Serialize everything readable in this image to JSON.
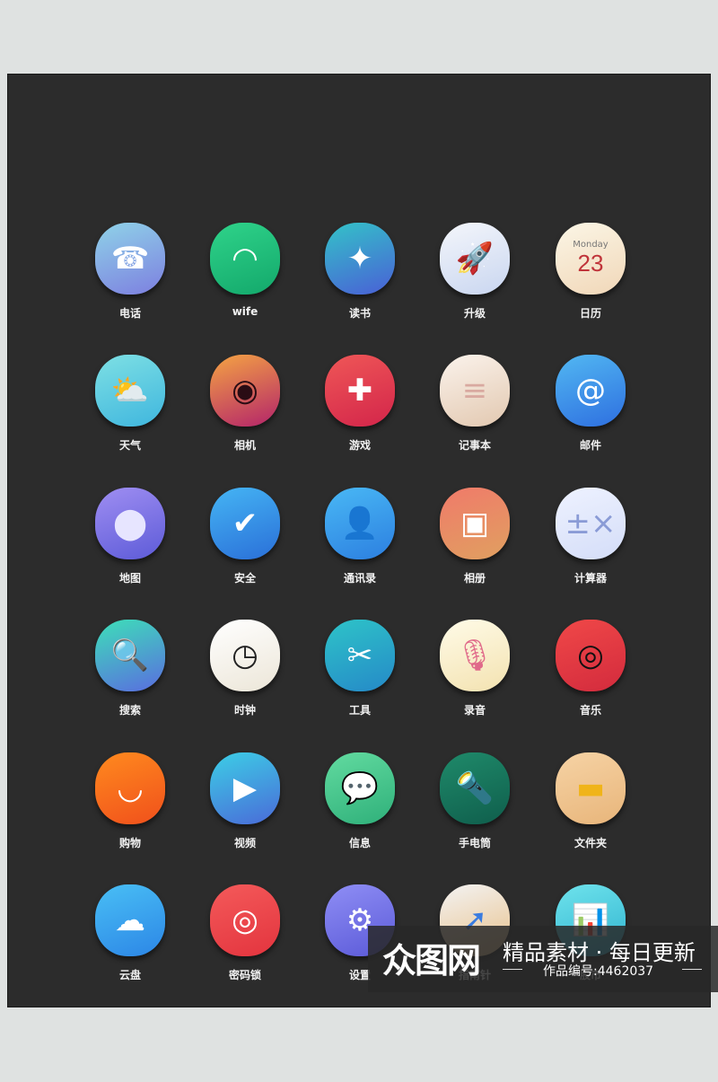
{
  "apps": [
    {
      "label": "电话",
      "icon": "telephone-icon",
      "glyph": "☎",
      "c1": "#8fd3e8",
      "c2": "#7d7fe0"
    },
    {
      "label": "wife",
      "icon": "wifi-icon",
      "glyph": "◠",
      "c1": "#2fd38a",
      "c2": "#13a86b"
    },
    {
      "label": "读书",
      "icon": "book-icon",
      "glyph": "✦",
      "c1": "#33c3c8",
      "c2": "#4a5fd6"
    },
    {
      "label": "升级",
      "icon": "rocket-icon",
      "glyph": "🚀",
      "c1": "#f4f6fb",
      "c2": "#c9d6f0",
      "fg": "#f08a1a"
    },
    {
      "label": "日历",
      "icon": "calendar-icon",
      "calendar": {
        "day": "Monday",
        "date": "23"
      },
      "c1": "#fbf6e6",
      "c2": "#f1d7b8"
    },
    {
      "label": "天气",
      "icon": "weather-icon",
      "glyph": "⛅",
      "c1": "#7ee0e4",
      "c2": "#3fb6de"
    },
    {
      "label": "相机",
      "icon": "camera-icon",
      "glyph": "◉",
      "c1": "#f5a443",
      "c2": "#b3236a",
      "fg": "#2a0c14"
    },
    {
      "label": "游戏",
      "icon": "gamepad-icon",
      "glyph": "✚",
      "c1": "#ef5757",
      "c2": "#d3254a"
    },
    {
      "label": "记事本",
      "icon": "notebook-icon",
      "glyph": "≡",
      "c1": "#fbf3ec",
      "c2": "#e2c8b0",
      "fg": "#d9a9a0"
    },
    {
      "label": "邮件",
      "icon": "mail-icon",
      "glyph": "@",
      "c1": "#52b8f2",
      "c2": "#2e6fe0"
    },
    {
      "label": "地图",
      "icon": "map-pin-icon",
      "glyph": "⬤",
      "c1": "#9f8ef2",
      "c2": "#5d5bd8",
      "fg": "#e7e5ff"
    },
    {
      "label": "安全",
      "icon": "shield-icon",
      "glyph": "✔",
      "c1": "#45b5f4",
      "c2": "#2a6fd8"
    },
    {
      "label": "通讯录",
      "icon": "contacts-icon",
      "glyph": "👤",
      "c1": "#49b8f5",
      "c2": "#2c7fe0"
    },
    {
      "label": "相册",
      "icon": "photo-album-icon",
      "glyph": "▣",
      "c1": "#f07a6a",
      "c2": "#e0a060"
    },
    {
      "label": "计算器",
      "icon": "calculator-icon",
      "glyph": "±×",
      "c1": "#eef2ff",
      "c2": "#d4ddf8",
      "fg": "#8a9bd6"
    },
    {
      "label": "搜索",
      "icon": "search-icon",
      "glyph": "🔍",
      "c1": "#3de0b8",
      "c2": "#5a6ce0"
    },
    {
      "label": "时钟",
      "icon": "clock-icon",
      "glyph": "◷",
      "c1": "#ffffff",
      "c2": "#ece6d8",
      "fg": "#222"
    },
    {
      "label": "工具",
      "icon": "tools-icon",
      "glyph": "✂",
      "c1": "#2ec4c8",
      "c2": "#2589c8"
    },
    {
      "label": "录音",
      "icon": "microphone-icon",
      "glyph": "🎙",
      "c1": "#fffbe8",
      "c2": "#f3e2b0",
      "fg": "#e06a8a"
    },
    {
      "label": "音乐",
      "icon": "music-record-icon",
      "glyph": "◎",
      "c1": "#f04848",
      "c2": "#d32b3d",
      "fg": "#111"
    },
    {
      "label": "购物",
      "icon": "shopping-icon",
      "glyph": "◡",
      "c1": "#ff8a1e",
      "c2": "#f0501c"
    },
    {
      "label": "视频",
      "icon": "video-play-icon",
      "glyph": "▶",
      "c1": "#3ccfe6",
      "c2": "#4a6ad8"
    },
    {
      "label": "信息",
      "icon": "message-icon",
      "glyph": "💬",
      "c1": "#62dba0",
      "c2": "#2fb07a"
    },
    {
      "label": "手电筒",
      "icon": "flashlight-icon",
      "glyph": "🔦",
      "c1": "#1f8a6a",
      "c2": "#0f5e4c"
    },
    {
      "label": "文件夹",
      "icon": "folder-icon",
      "glyph": "▬",
      "c1": "#f6d3a5",
      "c2": "#e8b57a",
      "fg": "#f0b419"
    },
    {
      "label": "云盘",
      "icon": "cloud-icon",
      "glyph": "☁",
      "c1": "#49bff5",
      "c2": "#2c86e6"
    },
    {
      "label": "密码锁",
      "icon": "fingerprint-icon",
      "glyph": "◎",
      "c1": "#f45a5a",
      "c2": "#e3343e"
    },
    {
      "label": "设置",
      "icon": "gear-icon",
      "glyph": "⚙",
      "c1": "#8f8ef5",
      "c2": "#5b5ad8"
    },
    {
      "label": "指南针",
      "icon": "compass-icon",
      "glyph": "➚",
      "c1": "#f3f3f3",
      "c2": "#e8c089",
      "fg": "#3a7ce0"
    },
    {
      "label": "股市",
      "icon": "stock-chart-icon",
      "glyph": "📊",
      "c1": "#6fe3ec",
      "c2": "#2fb3d0"
    }
  ],
  "watermark": {
    "logo": "众图网",
    "slogan": "精品素材 · 每日更新",
    "id": "作品编号:4462037"
  }
}
